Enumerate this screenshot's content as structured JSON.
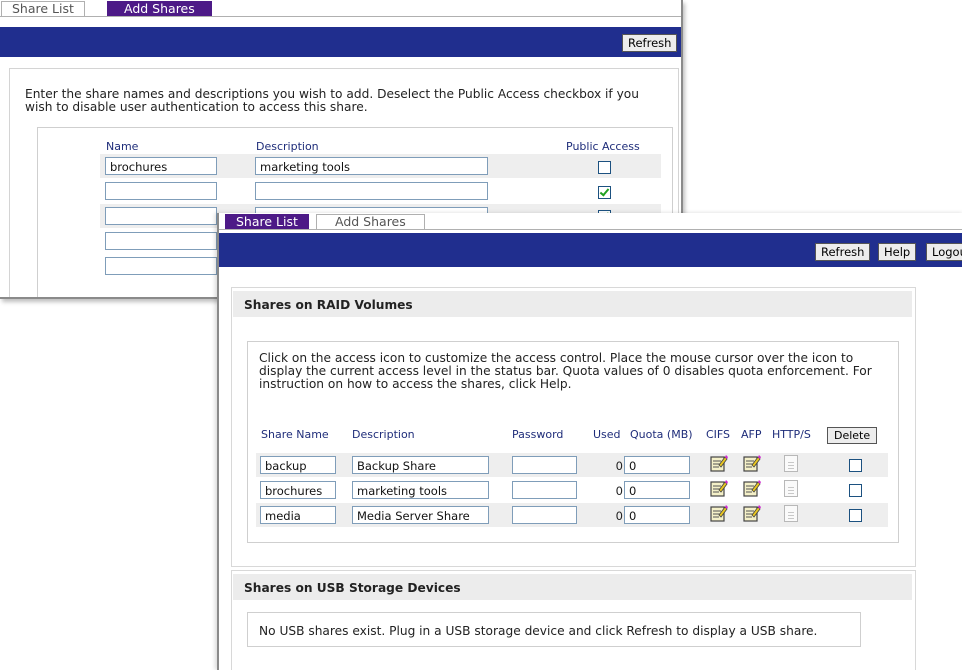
{
  "add_window": {
    "tabs": [
      "Share List",
      "Add Shares"
    ],
    "refresh_label": "Refresh",
    "intro": "Enter the share names and descriptions you wish to add. Deselect the Public Access checkbox if you wish to disable user authentication to access this share.",
    "columns": {
      "name": "Name",
      "description": "Description",
      "public_access": "Public Access"
    },
    "rows": [
      {
        "name": "brochures",
        "description": "marketing tools",
        "public": false
      },
      {
        "name": "",
        "description": "",
        "public": true
      },
      {
        "name": "",
        "description": "",
        "public": true
      },
      {
        "name": "",
        "description": "",
        "public": true
      },
      {
        "name": "",
        "description": "",
        "public": true
      }
    ]
  },
  "list_window": {
    "tabs": [
      "Share List",
      "Add Shares"
    ],
    "toolbar": {
      "refresh": "Refresh",
      "help": "Help",
      "logout": "Logou"
    },
    "raid_title": "Shares on RAID Volumes",
    "raid_intro": "Click on the access icon to customize the access control. Place the mouse cursor over the icon to display the current access level in the status bar. Quota values of 0 disables quota enforcement. For instruction on how to access the shares, click Help.",
    "columns": {
      "share_name": "Share Name",
      "description": "Description",
      "password": "Password",
      "used": "Used",
      "quota": "Quota (MB)",
      "cifs": "CIFS",
      "afp": "AFP",
      "http": "HTTP/S",
      "delete": "Delete"
    },
    "shares": [
      {
        "name": "backup",
        "description": "Backup Share",
        "password": "",
        "used": "0",
        "quota": "0"
      },
      {
        "name": "brochures",
        "description": "marketing tools",
        "password": "",
        "used": "0",
        "quota": "0"
      },
      {
        "name": "media",
        "description": "Media Server Share",
        "password": "",
        "used": "0",
        "quota": "0"
      }
    ],
    "usb_title": "Shares on USB Storage Devices",
    "usb_message": "No USB shares exist. Plug in a USB storage device and click Refresh to display a USB share."
  },
  "icons": {
    "cifs": "edit-access-icon",
    "afp": "edit-access-icon",
    "http": "document-icon"
  },
  "colors": {
    "tab_active": "#4d1a87",
    "toolbar": "#202e8e",
    "header_text": "#1f2d7a",
    "check": "#21a121"
  }
}
